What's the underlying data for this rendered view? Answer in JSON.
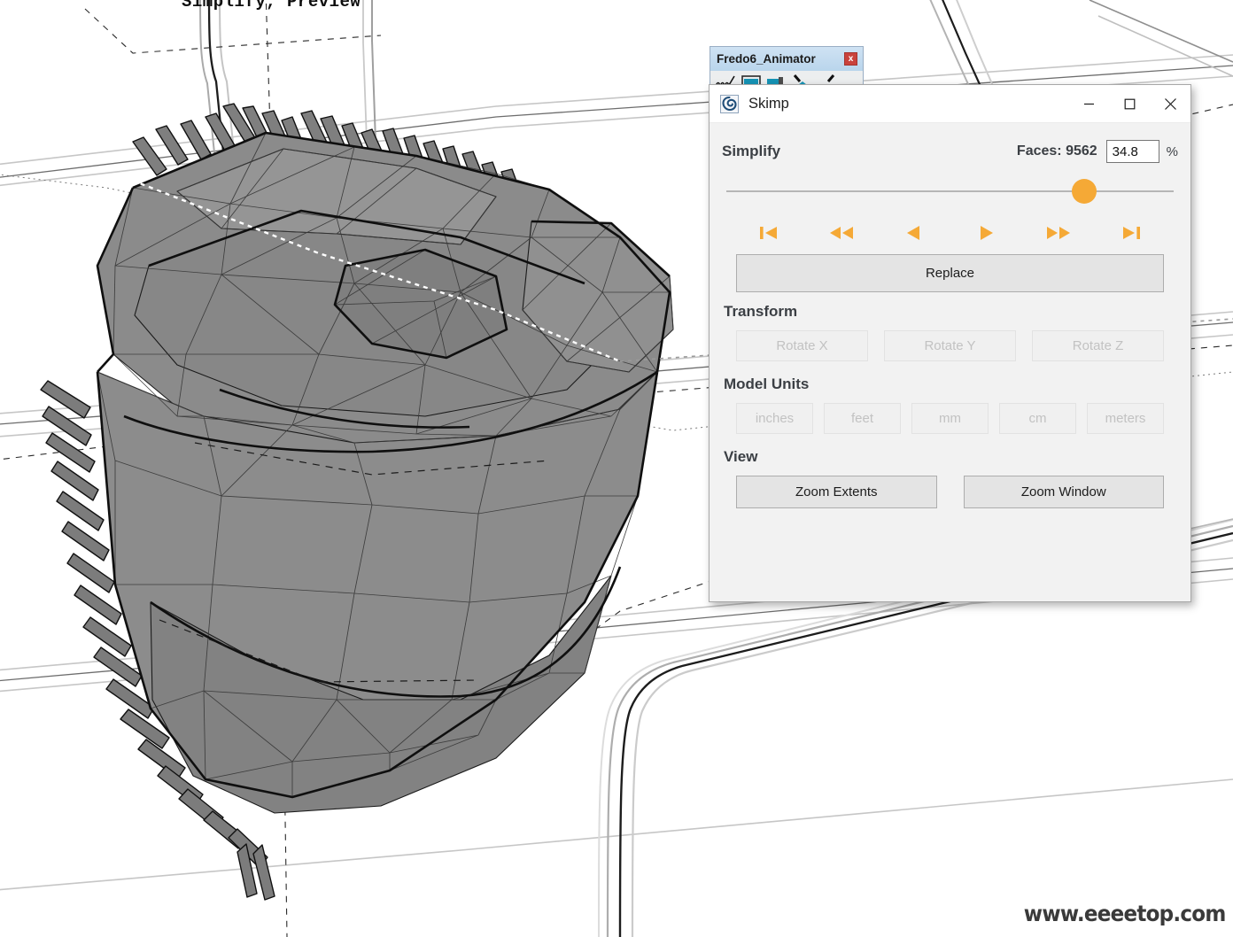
{
  "viewport": {
    "caption": "Simplify, Preview",
    "watermark": "www.eeeetop.com",
    "model_description": "low-poly triangulated scarf mesh in SketchUp wireframe scene",
    "model_fill": "#8a8a8a",
    "model_edge": "#1a1a1a",
    "scene_line": "#b9b9b9"
  },
  "fredo_window": {
    "title": "Fredo6_Animator",
    "close_label": "x",
    "titlebar_color": "#c2dcf0",
    "close_color": "#c9423c",
    "toolbar_icons": [
      "squiggle-icon",
      "screen-icon",
      "camera-icon",
      "pointer-icon",
      "pointer-alt-icon"
    ]
  },
  "skimp": {
    "title": "Skimp",
    "app_icon": "skimp-spiral-icon",
    "window_controls": [
      {
        "name": "minimize-button",
        "glyph": "minimize-icon"
      },
      {
        "name": "maximize-button",
        "glyph": "maximize-icon"
      },
      {
        "name": "close-button",
        "glyph": "close-icon"
      }
    ],
    "simplify": {
      "heading": "Simplify",
      "faces_label": "Faces: 9562",
      "faces_count": 9562,
      "percent_value": "34.8",
      "percent_sign": "%",
      "slider": {
        "value": 34.8,
        "handle_position_pct": 80,
        "handle_color": "#f5a936",
        "track_color": "#b6b6b6"
      },
      "playback_controls": [
        {
          "name": "skip-to-start-button",
          "icon": "skip-back-icon"
        },
        {
          "name": "rewind-button",
          "icon": "rewind-icon"
        },
        {
          "name": "step-back-button",
          "icon": "play-back-icon"
        },
        {
          "name": "step-forward-button",
          "icon": "play-forward-icon"
        },
        {
          "name": "fast-forward-button",
          "icon": "fast-forward-icon"
        },
        {
          "name": "skip-to-end-button",
          "icon": "skip-forward-icon"
        }
      ],
      "playback_color": "#f5a936",
      "replace_label": "Replace"
    },
    "transform": {
      "heading": "Transform",
      "buttons": [
        {
          "label": "Rotate X",
          "disabled": true
        },
        {
          "label": "Rotate Y",
          "disabled": true
        },
        {
          "label": "Rotate Z",
          "disabled": true
        }
      ]
    },
    "model_units": {
      "heading": "Model Units",
      "buttons": [
        {
          "label": "inches",
          "disabled": true
        },
        {
          "label": "feet",
          "disabled": true
        },
        {
          "label": "mm",
          "disabled": true
        },
        {
          "label": "cm",
          "disabled": true
        },
        {
          "label": "meters",
          "disabled": true
        }
      ]
    },
    "view": {
      "heading": "View",
      "buttons": [
        {
          "label": "Zoom Extents",
          "disabled": false
        },
        {
          "label": "Zoom Window",
          "disabled": false
        }
      ]
    }
  }
}
